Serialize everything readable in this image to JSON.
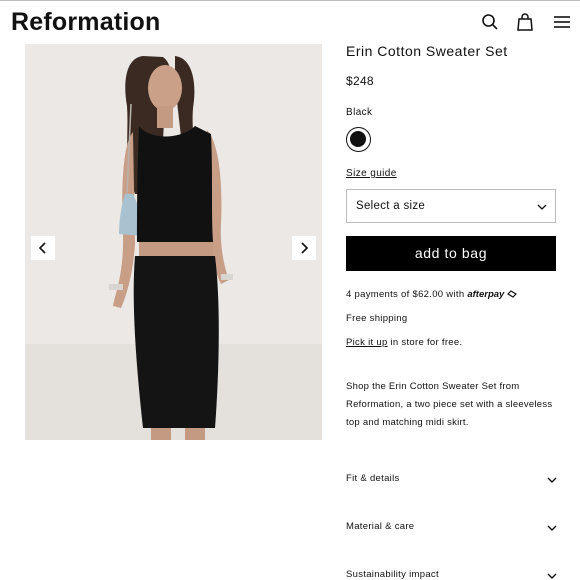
{
  "header": {
    "logo": "Reformation",
    "icons": [
      "search-icon",
      "bag-icon",
      "menu-icon"
    ]
  },
  "gallery": {
    "prev_icon": "chevron-left-icon",
    "next_icon": "chevron-right-icon"
  },
  "product": {
    "title": "Erin Cotton Sweater Set",
    "price": "$248",
    "color_label": "Black",
    "swatch_color": "#111111",
    "size_guide_label": "Size guide",
    "size_select_label": "Select a size",
    "add_to_bag_label": "add to bag",
    "payments_text": "4 payments of $62.00 with",
    "afterpay_label": "afterpay",
    "shipping_text": "Free shipping",
    "pickup_link": "Pick it up",
    "pickup_text": " in store for free.",
    "description": "Shop the Erin Cotton Sweater Set from Reformation, a two piece set with a sleeveless top and matching midi skirt."
  },
  "accordion": {
    "fit": "Fit & details",
    "material": "Material & care",
    "sustainability": "Sustainability impact"
  }
}
